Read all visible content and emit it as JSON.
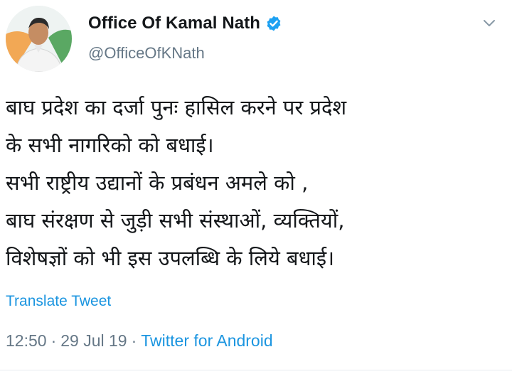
{
  "author": {
    "name": "Office Of Kamal Nath",
    "handle": "@OfficeOfKNath",
    "verified": true,
    "avatar_icon": "profile-photo"
  },
  "tweet": {
    "lines": [
      "बाघ प्रदेश का दर्जा पुनः हासिल करने पर प्रदेश",
      "के सभी नागरिको को बधाई।",
      "सभी राष्ट्रीय उद्यानों के प्रबंधन अमले को ,",
      "बाघ संरक्षण से जुड़ी सभी संस्थाओं, व्यक्तियों,",
      "विशेषज्ञों को भी इस उपलब्धि के लिये बधाई।"
    ],
    "translate_label": "Translate Tweet",
    "time": "12:50",
    "date": "29 Jul 19",
    "separator": "·",
    "source": "Twitter for Android"
  },
  "icons": {
    "verified": "verified-badge-icon",
    "menu": "chevron-down-icon"
  },
  "colors": {
    "text": "#14171a",
    "secondary": "#657786",
    "link": "#1b95e0",
    "verified": "#1da1f2"
  }
}
